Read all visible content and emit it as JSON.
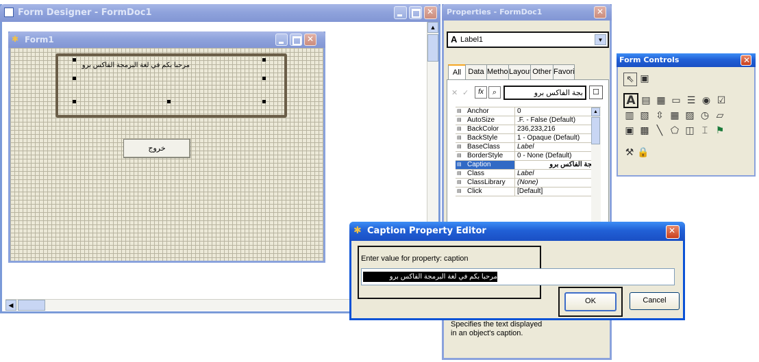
{
  "form_designer": {
    "title": "Form Designer - FormDoc1",
    "form": {
      "title": "Form1",
      "label_caption": "مرحبا بكم في لغة البرمجة الفاكس برو",
      "button_caption": "خروج"
    }
  },
  "properties": {
    "title": "Properties - FormDoc1",
    "object_selector": "Label1",
    "tabs": [
      "All",
      "Data",
      "Methods",
      "Layout",
      "Other",
      "Favorites"
    ],
    "edit_value": "بجة الفاكس برو",
    "rows": [
      {
        "name": "Anchor",
        "value": "0"
      },
      {
        "name": "AutoSize",
        "value": ".F. - False (Default)"
      },
      {
        "name": "BackColor",
        "value": "236,233,216"
      },
      {
        "name": "BackStyle",
        "value": "1 - Opaque (Default)"
      },
      {
        "name": "BaseClass",
        "value": "Label"
      },
      {
        "name": "BorderStyle",
        "value": "0 - None (Default)"
      },
      {
        "name": "Caption",
        "value": "بجة الفاكس برو"
      },
      {
        "name": "Class",
        "value": "Label"
      },
      {
        "name": "ClassLibrary",
        "value": "(None)"
      },
      {
        "name": "Click",
        "value": "[Default]"
      }
    ],
    "description": "Specifies the text displayed in an object's caption."
  },
  "form_controls": {
    "title": "Form Controls",
    "icons": [
      "pointer-icon",
      "view-classes-icon",
      "label-icon",
      "textbox-icon",
      "editbox-icon",
      "commandbutton-icon",
      "commandgroup-icon",
      "optiongroup-icon",
      "checkbox-icon",
      "combobox-icon",
      "listbox-icon",
      "spinner-icon",
      "grid-icon",
      "image-icon",
      "timer-icon",
      "pageframe-icon",
      "ole-container-icon",
      "ole-bound-icon",
      "line-icon",
      "shape-icon",
      "container-icon",
      "separator-icon",
      "hyperlink-icon",
      "builder-lock-icon",
      "button-lock-icon"
    ]
  },
  "caption_editor": {
    "title": "Caption Property Editor",
    "prompt": "Enter value for property: caption",
    "value": "مرحبا بكم في لغة البرمجة الفاكس برو",
    "ok_label": "OK",
    "cancel_label": "Cancel"
  },
  "colors": {
    "xp_title_blue": "#2160d6",
    "selection_blue": "#316ac5",
    "dialog_face": "#ece9d8"
  }
}
